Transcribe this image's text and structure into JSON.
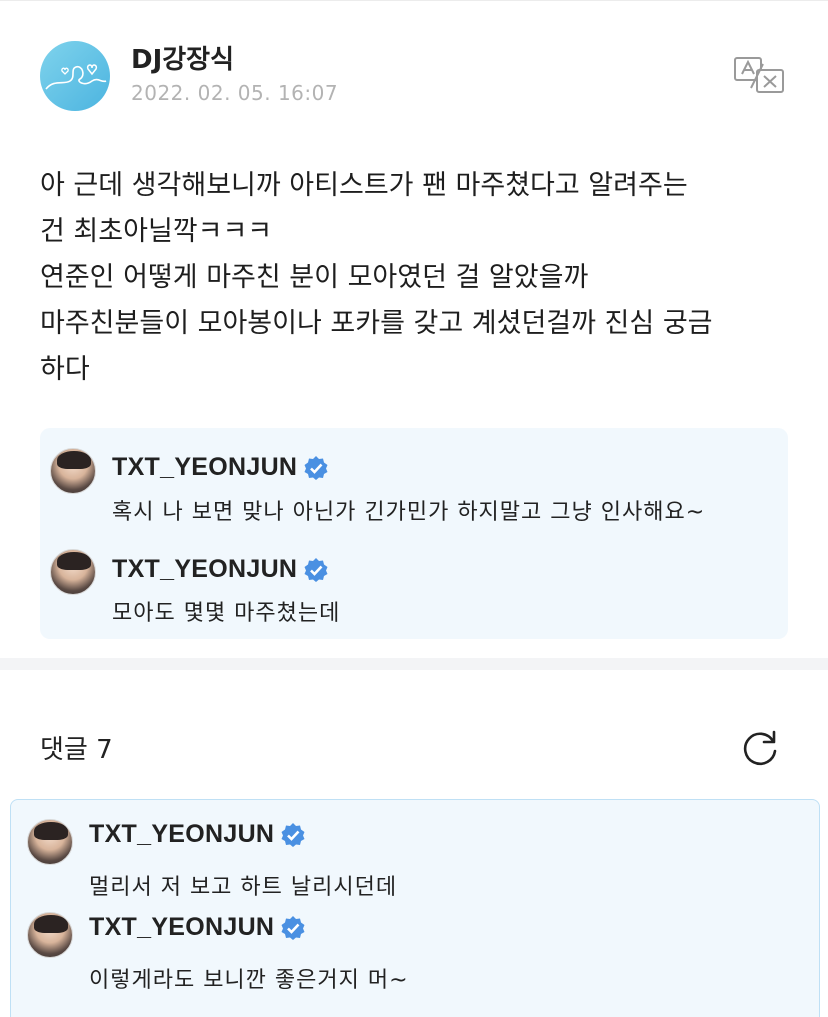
{
  "post": {
    "author_name": "DJ강장식",
    "date": "2022. 02. 05. 16:07",
    "body_lines": [
      "아 근데 생각해보니까 아티스트가 팬 마주쳤다고 알려주는",
      "건 최초아닐깍ㅋㅋㅋ",
      "연준인 어떻게 마주친 분이 모아였던 걸 알았을까",
      "마주친분들이 모아봉이나 포카를 갖고 계셨던걸까 진심 궁금",
      "하다"
    ],
    "quoted_messages": [
      {
        "name": "TXT_YEONJUN",
        "text": "혹시 나 보면 맞나 아닌가 긴가민가 하지말고 그냥 인사해요~"
      },
      {
        "name": "TXT_YEONJUN",
        "text": "모아도 몇몇 마주쳤는데"
      }
    ]
  },
  "comments": {
    "header": "댓글 7",
    "items": [
      {
        "name": "TXT_YEONJUN",
        "text": "멀리서 저 보고 하트 날리시던데"
      },
      {
        "name": "TXT_YEONJUN",
        "text": "이렇게라도 보니깐 좋은거지 머~"
      }
    ]
  },
  "icons": {
    "translate": "translate-icon",
    "refresh": "refresh-icon",
    "verified": "verified-badge-icon"
  },
  "colors": {
    "card_background": "#f1f8fd",
    "verified_blue": "#4a90e2",
    "date_gray": "#b3b3b3"
  }
}
